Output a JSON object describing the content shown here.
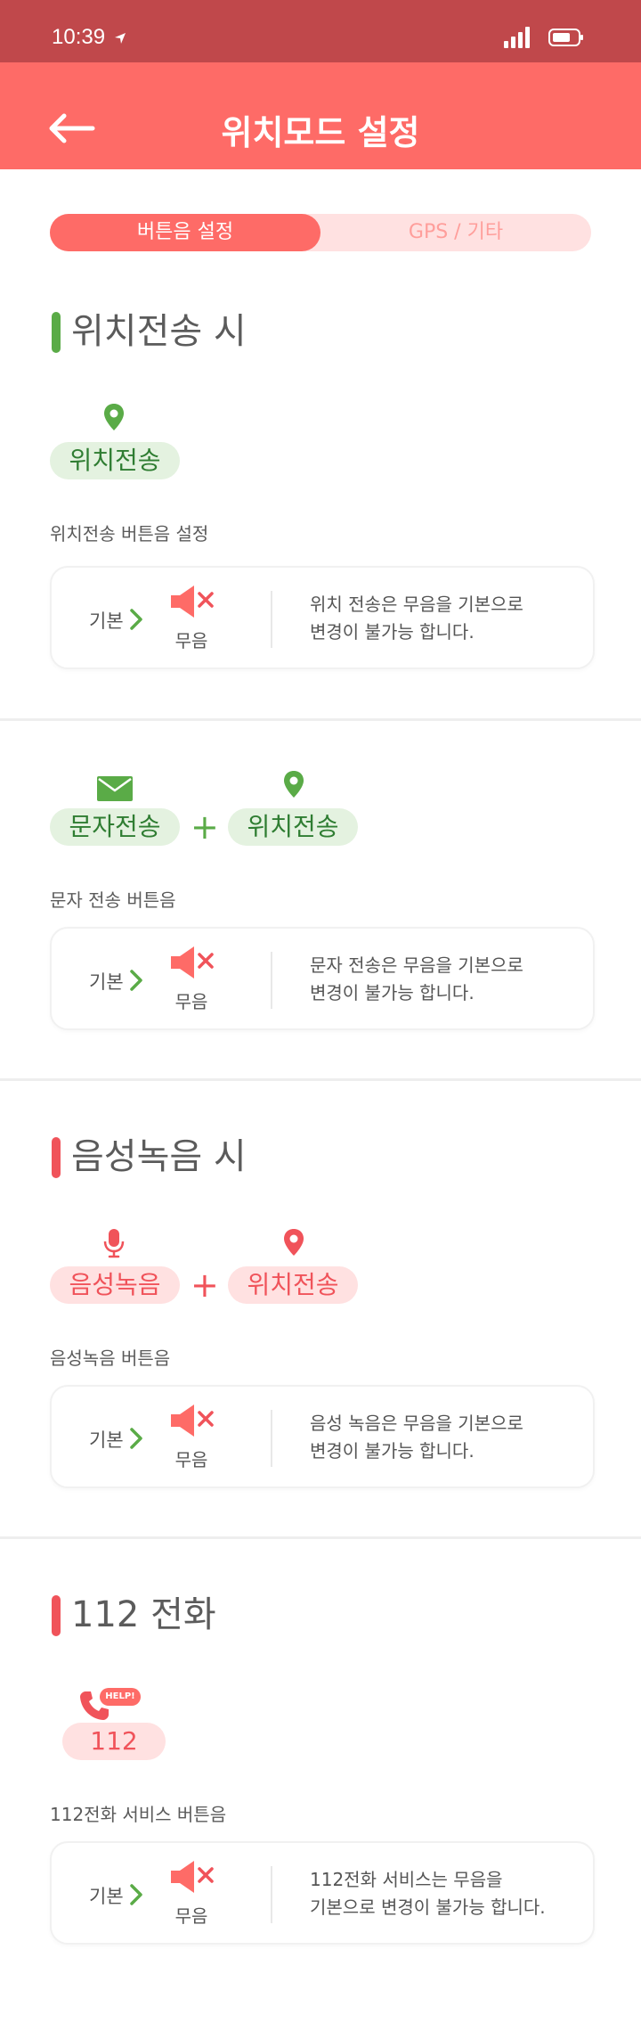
{
  "status_bar": {
    "time": "10:39"
  },
  "header": {
    "title": "위치모드 설정"
  },
  "tabs": [
    {
      "label": "버튼음 설정"
    },
    {
      "label": "GPS / 기타"
    }
  ],
  "colors": {
    "header": "#fe6b67",
    "status": "#c0484b",
    "green": "#5aab47",
    "red": "#f0535a"
  },
  "sections": [
    {
      "title": "위치전송 시",
      "pills": [
        "위치전송"
      ],
      "sub_label": "위치전송 버튼음 설정",
      "card": {
        "default_label": "기본",
        "mute_label": "무음",
        "desc_line1": "위치 전송은 무음을 기본으로",
        "desc_line2": "변경이 불가능 합니다."
      }
    },
    {
      "title": "",
      "pills": [
        "문자전송",
        "위치전송"
      ],
      "plus": "+",
      "sub_label": "문자 전송 버튼음",
      "card": {
        "default_label": "기본",
        "mute_label": "무음",
        "desc_line1": "문자 전송은 무음을 기본으로",
        "desc_line2": "변경이 불가능 합니다."
      }
    },
    {
      "title": "음성녹음 시",
      "pills": [
        "음성녹음",
        "위치전송"
      ],
      "plus": "+",
      "sub_label": "음성녹음 버튼음",
      "card": {
        "default_label": "기본",
        "mute_label": "무음",
        "desc_line1": "음성 녹음은 무음을 기본으로",
        "desc_line2": "변경이 불가능 합니다."
      }
    },
    {
      "title": "112 전화",
      "pills": [
        "112"
      ],
      "help_badge": "HELP!",
      "sub_label": "112전화 서비스 버튼음",
      "card": {
        "default_label": "기본",
        "mute_label": "무음",
        "desc_line1": "112전화 서비스는 무음을",
        "desc_line2": "기본으로 변경이 불가능 합니다."
      }
    }
  ]
}
